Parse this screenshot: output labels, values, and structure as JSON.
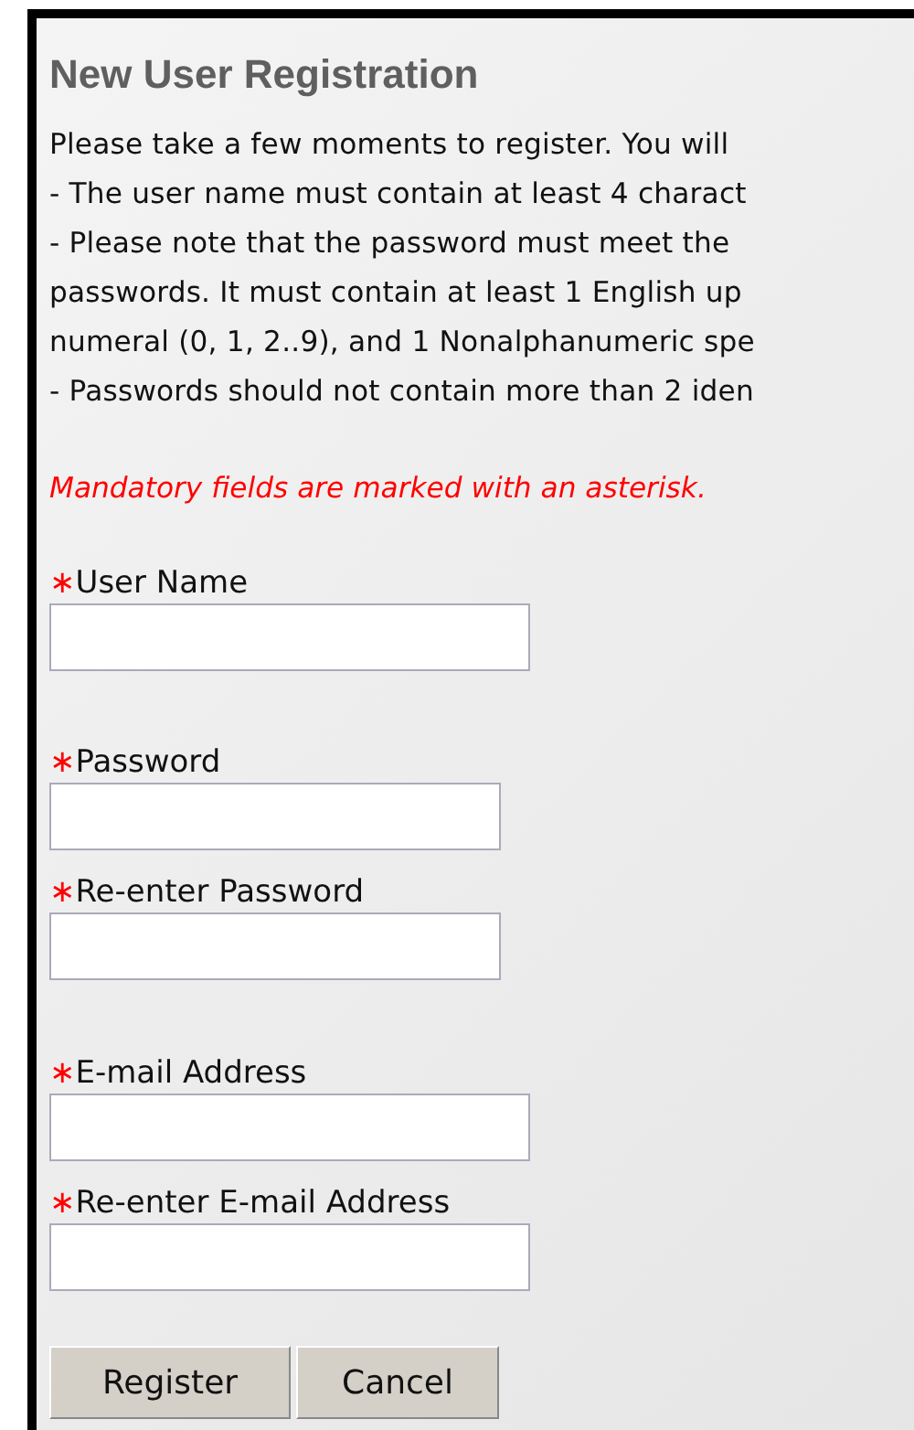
{
  "title": "New User Registration",
  "instructions": [
    "Please take a few moments to register. You will",
    "- The user name must contain at least 4 charact",
    "- Please note that the password must meet the",
    "passwords. It must contain at least 1 English up",
    "numeral (0, 1, 2..9), and 1 Nonalphanumeric spe",
    "- Passwords should not contain more than 2 iden"
  ],
  "notice": "Mandatory fields are marked with an asterisk.",
  "fields": [
    {
      "marker": "∗",
      "label": "User Name"
    },
    {
      "marker": "∗",
      "label": "Password"
    },
    {
      "marker": "∗",
      "label": "Re-enter Password"
    },
    {
      "marker": "∗",
      "label": "E-mail Address"
    },
    {
      "marker": "∗",
      "label": "Re-enter E-mail Address"
    }
  ],
  "buttons": [
    "Register",
    "Cancel"
  ]
}
